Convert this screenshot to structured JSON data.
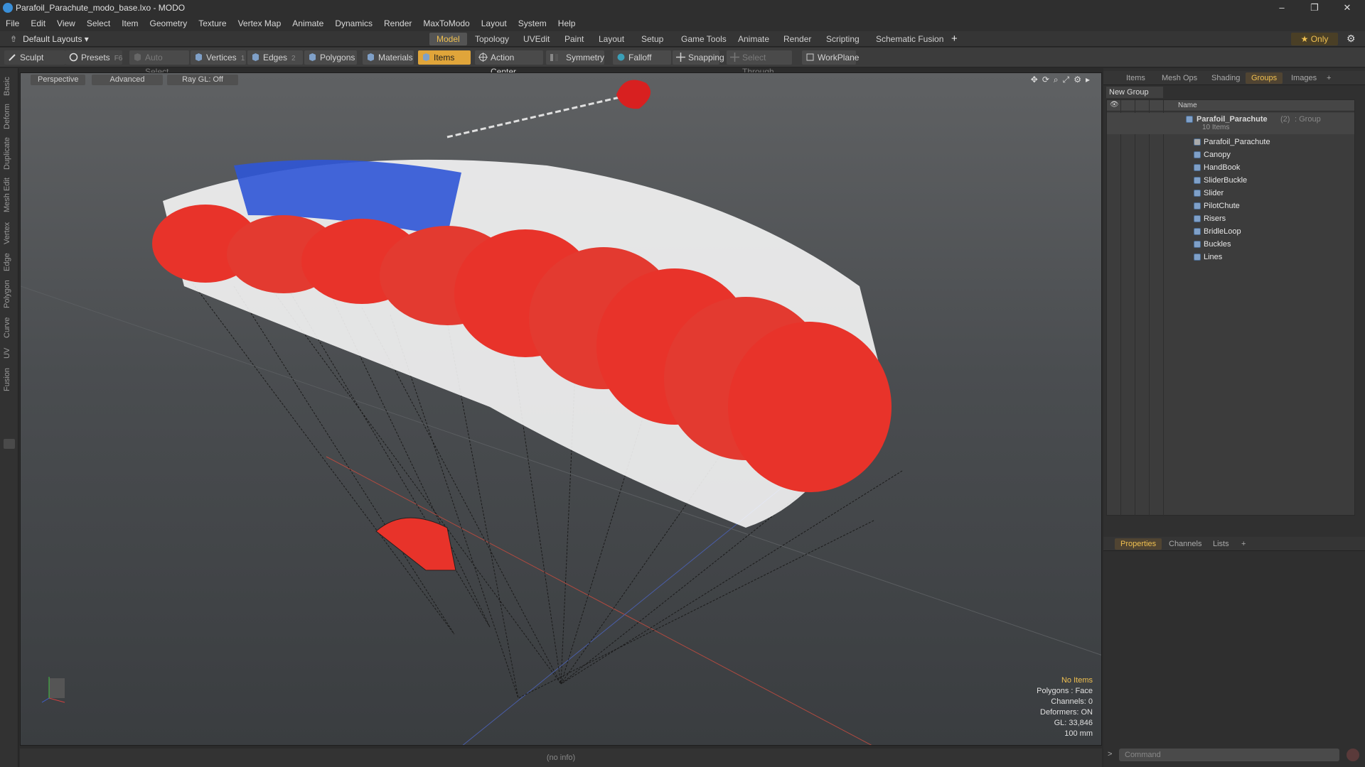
{
  "window": {
    "title": "Parafoil_Parachute_modo_base.lxo - MODO",
    "minimize": "–",
    "restore": "❐",
    "close": "✕"
  },
  "menu": [
    "File",
    "Edit",
    "View",
    "Select",
    "Item",
    "Geometry",
    "Texture",
    "Vertex Map",
    "Animate",
    "Dynamics",
    "Render",
    "MaxToModo",
    "Layout",
    "System",
    "Help"
  ],
  "layout_selector": "Default Layouts ▾",
  "tabs": [
    "Model",
    "Topology",
    "UVEdit",
    "Paint",
    "Layout",
    "Setup",
    "Game Tools",
    "Animate",
    "Render",
    "Scripting",
    "Schematic Fusion"
  ],
  "tabs_plus": "+",
  "only_button": "★  Only",
  "toolbar": {
    "sculpt": "Sculpt",
    "presets": "Presets",
    "presets_key": "F6",
    "auto_select": "Auto Select",
    "vertices": "Vertices",
    "vertices_key": "1",
    "edges": "Edges",
    "edges_key": "2",
    "polygons": "Polygons",
    "materials": "Materials",
    "items": "Items",
    "action_center": "Action Center",
    "symmetry": "Symmetry",
    "falloff": "Falloff",
    "snapping": "Snapping",
    "select_through": "Select Through",
    "workplane": "WorkPlane"
  },
  "left_tabs": [
    "Basic",
    "Deform",
    "Duplicate",
    "Mesh Edit",
    "Vertex",
    "Edge",
    "Polygon",
    "Curve",
    "UV",
    "Fusion"
  ],
  "viewport": {
    "view": "Perspective",
    "advanced": "Advanced",
    "raygl": "Ray GL: Off",
    "info": {
      "items": "No Items",
      "polygons": "Polygons : Face",
      "channels": "Channels: 0",
      "deformers": "Deformers: ON",
      "gl": "GL: 33,846",
      "scale": "100 mm"
    }
  },
  "status": "(no info)",
  "right_panel": {
    "tabs": [
      "Items",
      "Mesh Ops",
      "Shading",
      "Groups",
      "Images",
      "+"
    ],
    "new_group": "New Group",
    "name_header": "Name",
    "group_name": "Parafoil_Parachute",
    "group_count": "(2)",
    "group_type": ": Group",
    "group_items": "10 Items",
    "members": [
      "Parafoil_Parachute",
      "Canopy",
      "HandBook",
      "SliderBuckle",
      "Slider",
      "PilotChute",
      "Risers",
      "BridleLoop",
      "Buckles",
      "Lines"
    ],
    "lower_tabs": [
      "Properties",
      "Channels",
      "Lists",
      "+"
    ],
    "command_placeholder": "Command"
  },
  "colors": {
    "accent": "#f0c050",
    "canopy_red": "#e8332a",
    "canopy_blue": "#2f55d6"
  }
}
